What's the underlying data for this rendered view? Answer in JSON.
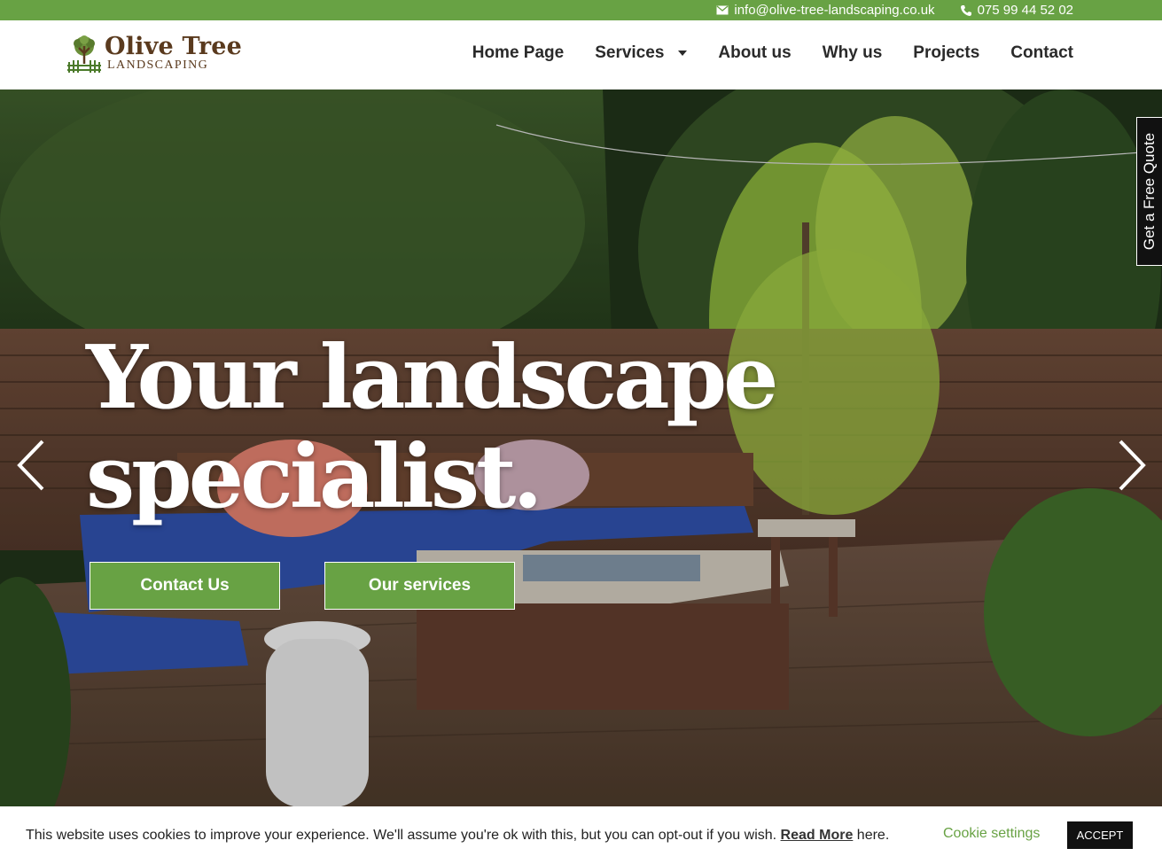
{
  "topbar": {
    "email": "info@olive-tree-landscaping.co.uk",
    "phone": "075 99 44 52 02",
    "email_icon": "envelope-icon",
    "phone_icon": "phone-icon"
  },
  "logo": {
    "title": "Olive Tree",
    "subtitle": "LANDSCAPING"
  },
  "nav": {
    "items": [
      {
        "label": "Home Page"
      },
      {
        "label": "Services"
      },
      {
        "label": "About us"
      },
      {
        "label": "Why us"
      },
      {
        "label": "Projects"
      },
      {
        "label": "Contact"
      }
    ]
  },
  "hero": {
    "headline_line1": "Your landscape",
    "headline_line2": "specialist.",
    "contact_button": "Contact Us",
    "services_button": "Our services",
    "prev_icon": "chevron-left-icon",
    "next_icon": "chevron-right-icon"
  },
  "quote_tab": {
    "label": "Get a Free Quote"
  },
  "cookie": {
    "text_before": "This website uses cookies to improve your experience. We'll assume you're ok with this, but you can opt-out if you wish. ",
    "read_more": "Read More",
    "text_after": " here.",
    "settings": "Cookie settings",
    "accept": "ACCEPT"
  },
  "colors": {
    "brand_green": "#68a244",
    "logo_brown": "#5a3a1e",
    "nav_text": "#2a2a2a"
  }
}
